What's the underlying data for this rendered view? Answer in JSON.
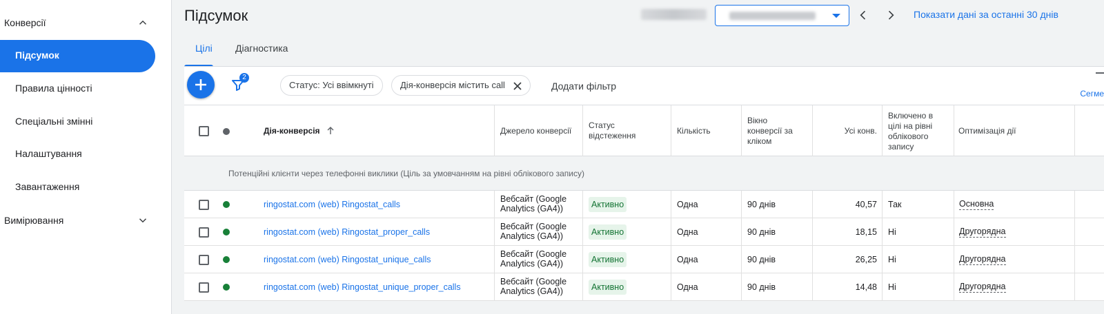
{
  "sidebar": {
    "group_conversions": "Конверсії",
    "items": [
      "Підсумок",
      "Правила цінності",
      "Спеціальні змінні",
      "Налаштування",
      "Завантаження"
    ],
    "group_measurement": "Вимірювання"
  },
  "header": {
    "title": "Підсумок",
    "show_last_30": "Показати дані за останні 30 днів"
  },
  "tabs": [
    "Цілі",
    "Діагностика"
  ],
  "toolbar": {
    "filter_count": "2",
    "chips": [
      "Статус: Усі ввімкнуті",
      "Дія-конверсія містить call"
    ],
    "add_filter": "Додати фільтр",
    "segment": "Сегме"
  },
  "table": {
    "columns": {
      "action": "Дія-конверсія",
      "source": "Джерело конверсії",
      "status": "Статус відстеження",
      "count": "Кількість",
      "window": "Вікно конверсії за кліком",
      "all_conv": "Усі конв.",
      "included": "Включено в цілі на рівні облікового запису",
      "optimization": "Оптимізація дії"
    },
    "group_label": "Потенційні клієнти через телефонні виклики (Ціль за умовчанням на рівні облікового запису)",
    "rows": [
      {
        "action": "ringostat.com (web) Ringostat_calls",
        "source": "Вебсайт (Google Analytics (GA4))",
        "status": "Активно",
        "count": "Одна",
        "window": "90 днів",
        "all_conv": "40,57",
        "included": "Так",
        "optimization": "Основна"
      },
      {
        "action": "ringostat.com (web) Ringostat_proper_calls",
        "source": "Вебсайт (Google Analytics (GA4))",
        "status": "Активно",
        "count": "Одна",
        "window": "90 днів",
        "all_conv": "18,15",
        "included": "Ні",
        "optimization": "Другорядна"
      },
      {
        "action": "ringostat.com (web) Ringostat_unique_calls",
        "source": "Вебсайт (Google Analytics (GA4))",
        "status": "Активно",
        "count": "Одна",
        "window": "90 днів",
        "all_conv": "26,25",
        "included": "Ні",
        "optimization": "Другорядна"
      },
      {
        "action": "ringostat.com (web) Ringostat_unique_proper_calls",
        "source": "Вебсайт (Google Analytics (GA4))",
        "status": "Активно",
        "count": "Одна",
        "window": "90 днів",
        "all_conv": "14,48",
        "included": "Ні",
        "optimization": "Другорядна"
      }
    ]
  },
  "colors": {
    "accent": "#1a73e8",
    "active_green": "#188038",
    "active_bg": "#e6f4ea"
  }
}
